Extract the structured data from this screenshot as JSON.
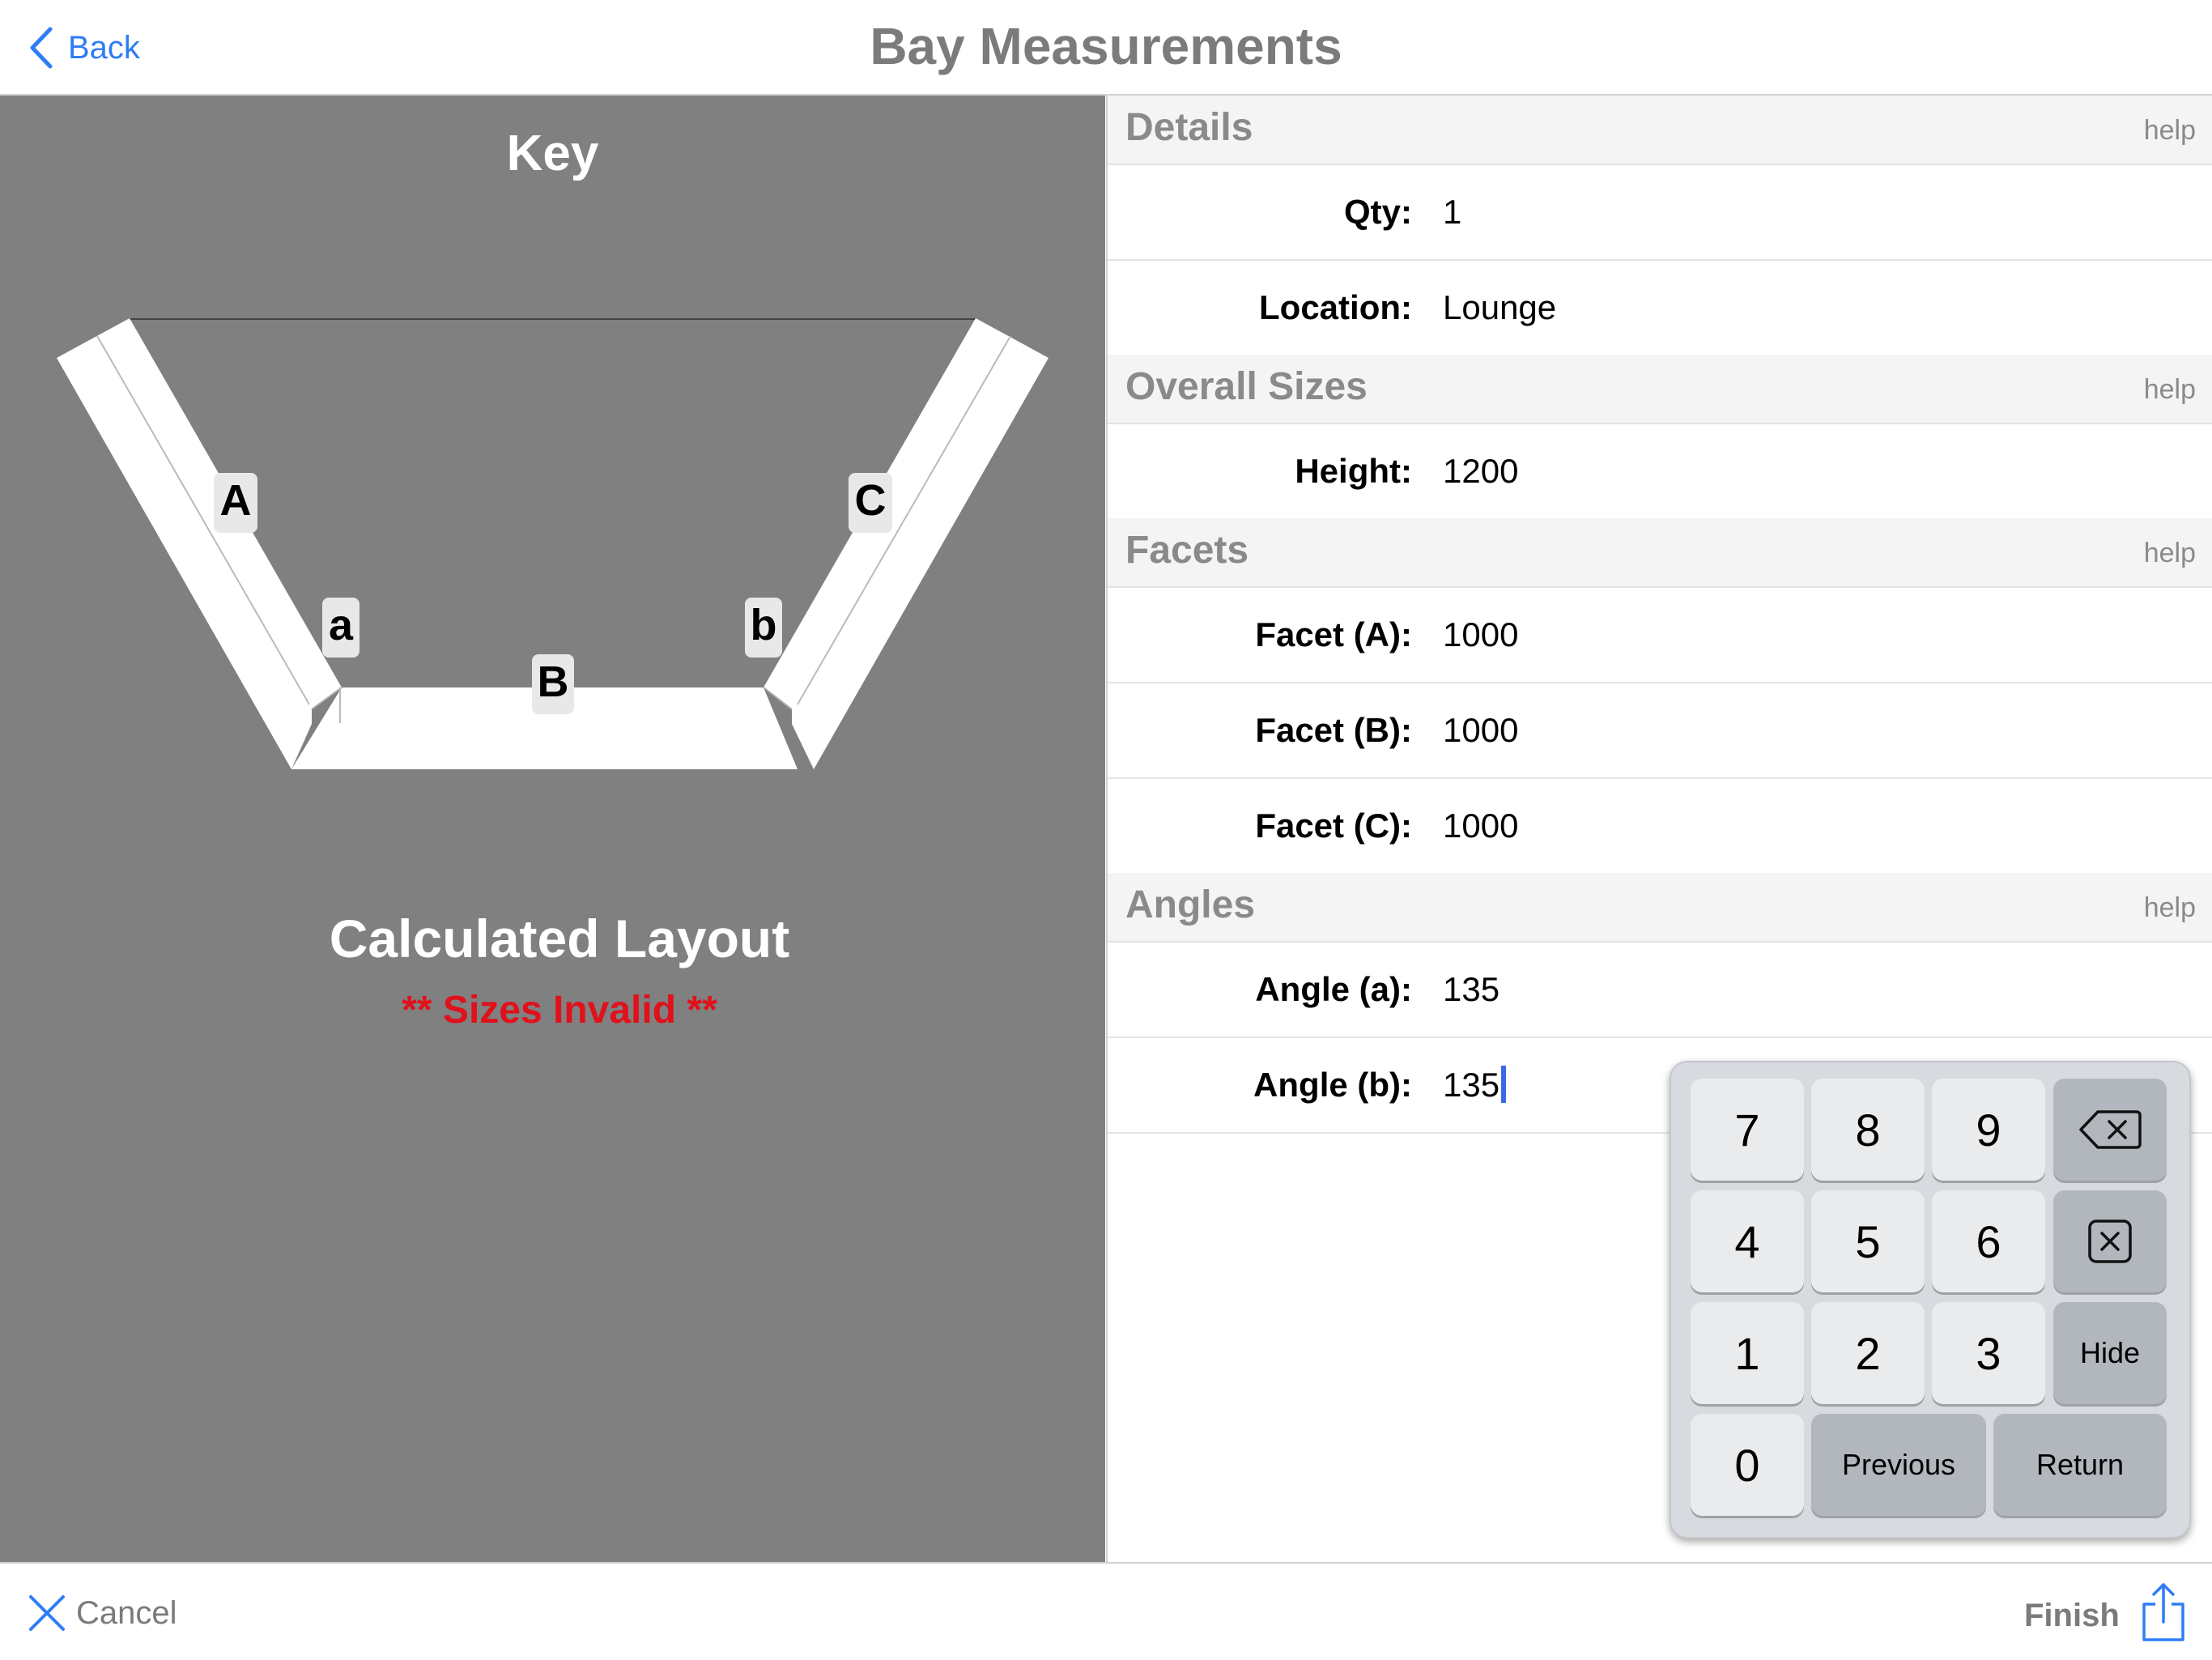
{
  "nav": {
    "back_label": "Back",
    "title": "Bay Measurements"
  },
  "key_panel": {
    "title": "Key",
    "diagram_labels": {
      "A": "A",
      "B": "B",
      "C": "C",
      "a": "a",
      "b": "b"
    },
    "calc_title": "Calculated Layout",
    "status_text": "** Sizes Invalid **",
    "status_color": "#e0111b"
  },
  "form": {
    "sections": {
      "details": {
        "title": "Details",
        "help": "help"
      },
      "overall": {
        "title": "Overall Sizes",
        "help": "help"
      },
      "facets": {
        "title": "Facets",
        "help": "help"
      },
      "angles": {
        "title": "Angles",
        "help": "help"
      }
    },
    "fields": {
      "qty": {
        "label": "Qty:",
        "value": "1"
      },
      "location": {
        "label": "Location:",
        "value": "Lounge"
      },
      "height": {
        "label": "Height:",
        "value": "1200"
      },
      "facet_a": {
        "label": "Facet (A):",
        "value": "1000"
      },
      "facet_b": {
        "label": "Facet (B):",
        "value": "1000"
      },
      "facet_c": {
        "label": "Facet (C):",
        "value": "1000"
      },
      "angle_a": {
        "label": "Angle (a):",
        "value": "135"
      },
      "angle_b": {
        "label": "Angle (b):",
        "value": "135"
      }
    }
  },
  "keypad": {
    "keys": [
      "7",
      "8",
      "9",
      "4",
      "5",
      "6",
      "1",
      "2",
      "3",
      "0"
    ],
    "hide_label": "Hide",
    "previous_label": "Previous",
    "return_label": "Return",
    "backspace_icon": "backspace-icon",
    "clear_icon": "clear-x-icon"
  },
  "bottom": {
    "cancel_label": "Cancel",
    "finish_label": "Finish"
  },
  "colors": {
    "accent": "#2f7df6",
    "panel": "#808080",
    "muted": "#7b7b7b"
  }
}
